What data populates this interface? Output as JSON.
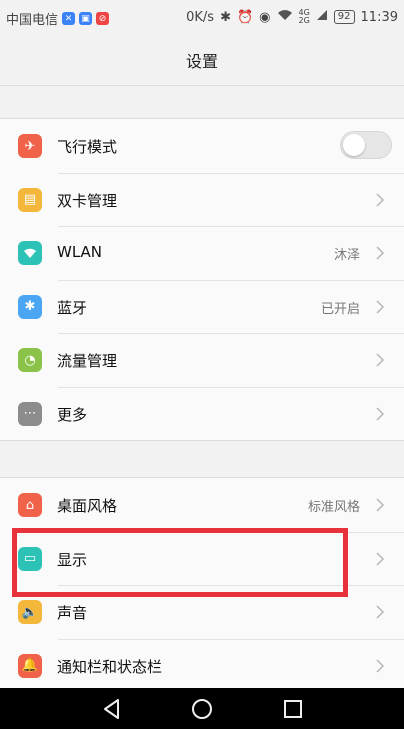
{
  "statusbar": {
    "carrier": "中国电信",
    "net_speed": "0K/s",
    "battery": "92",
    "time": "11:39",
    "net_type_top": "4G",
    "net_type_bottom": "2G",
    "notif_icons": [
      "app-notification-icon",
      "image-notification-icon",
      "app-notification-icon"
    ]
  },
  "header": {
    "title": "设置"
  },
  "group1": {
    "items": [
      {
        "label": "飞行模式",
        "icon": "airplane-icon",
        "color": "#f0634a",
        "toggle": true,
        "toggle_on": false
      },
      {
        "label": "双卡管理",
        "icon": "sim-card-icon",
        "color": "#f3b83b"
      },
      {
        "label": "WLAN",
        "icon": "wifi-icon",
        "color": "#2cc2b6",
        "value": "沐泽"
      },
      {
        "label": "蓝牙",
        "icon": "bluetooth-icon",
        "color": "#4aa6f2",
        "value": "已开启"
      },
      {
        "label": "流量管理",
        "icon": "data-usage-icon",
        "color": "#8bc34a"
      },
      {
        "label": "更多",
        "icon": "more-icon",
        "color": "#8c8c8c"
      }
    ]
  },
  "group2": {
    "items": [
      {
        "label": "桌面风格",
        "icon": "home-style-icon",
        "color": "#f0634a",
        "value": "标准风格"
      },
      {
        "label": "显示",
        "icon": "display-icon",
        "color": "#2cc2b6"
      },
      {
        "label": "声音",
        "icon": "sound-icon",
        "color": "#f3b83b"
      },
      {
        "label": "通知栏和状态栏",
        "icon": "notification-icon",
        "color": "#f0634a"
      }
    ]
  },
  "colors": {
    "highlight": "#e8313a",
    "background": "#f2f2f2"
  }
}
